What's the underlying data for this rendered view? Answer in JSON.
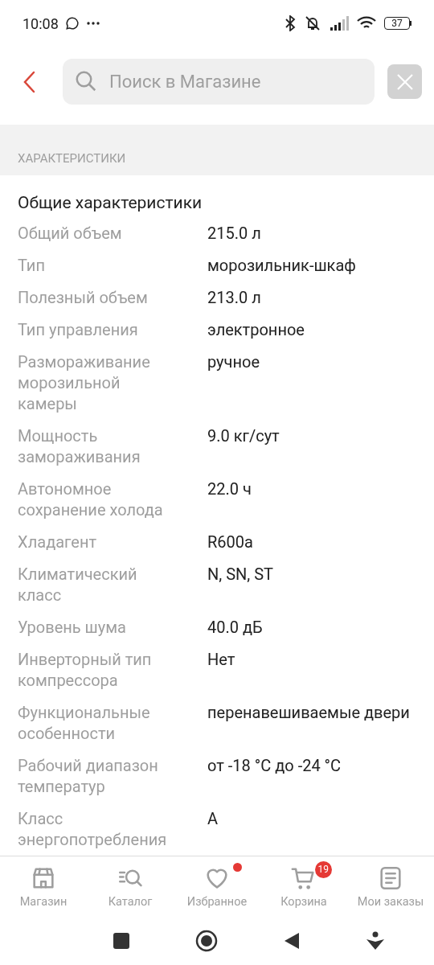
{
  "status_bar": {
    "time": "10:08",
    "battery": "37"
  },
  "search": {
    "placeholder": "Поиск в Магазине"
  },
  "section": {
    "title": "ХАРАКТЕРИСТИКИ"
  },
  "group": {
    "title": "Общие характеристики",
    "rows": [
      {
        "label": "Общий объем",
        "value": "215.0 л"
      },
      {
        "label": "Тип",
        "value": "морозильник-шкаф"
      },
      {
        "label": "Полезный объем",
        "value": "213.0 л"
      },
      {
        "label": "Тип управления",
        "value": "электронное"
      },
      {
        "label": "Размораживание морозильной камеры",
        "value": "ручное"
      },
      {
        "label": "Мощность замораживания",
        "value": "9.0 кг/сут"
      },
      {
        "label": "Автономное сохранение холода",
        "value": "22.0 ч"
      },
      {
        "label": "Хладагент",
        "value": "R600a"
      },
      {
        "label": "Климатический класс",
        "value": "N, SN, ST"
      },
      {
        "label": "Уровень шума",
        "value": "40.0 дБ"
      },
      {
        "label": "Инверторный тип компрессора",
        "value": "Нет"
      },
      {
        "label": "Функциональные особенности",
        "value": "перенавешиваемые двери"
      },
      {
        "label": "Рабочий диапазон температур",
        "value": "от -18 °C до -24 °C"
      },
      {
        "label": "Класс энергопотребления",
        "value": "A"
      }
    ]
  },
  "bottom_nav": [
    {
      "kind": "store",
      "label": "Магазин",
      "dot": false
    },
    {
      "kind": "catalog",
      "label": "Каталог",
      "dot": false
    },
    {
      "kind": "favorites",
      "label": "Избранное",
      "dot": true
    },
    {
      "kind": "cart",
      "label": "Корзина",
      "dot": false,
      "badge": "19"
    },
    {
      "kind": "orders",
      "label": "Мои заказы",
      "dot": false
    }
  ]
}
